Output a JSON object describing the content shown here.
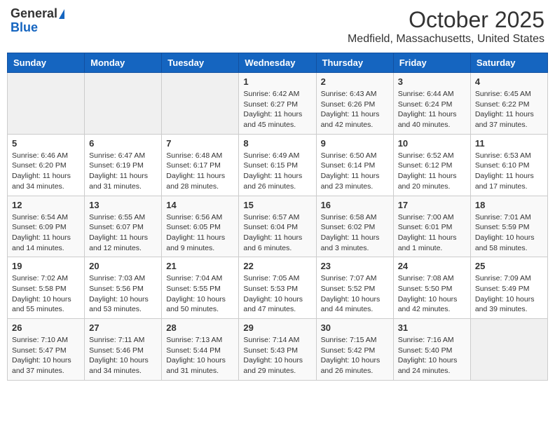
{
  "header": {
    "logo_general": "General",
    "logo_blue": "Blue",
    "month": "October 2025",
    "location": "Medfield, Massachusetts, United States"
  },
  "days_of_week": [
    "Sunday",
    "Monday",
    "Tuesday",
    "Wednesday",
    "Thursday",
    "Friday",
    "Saturday"
  ],
  "weeks": [
    [
      {
        "day": "",
        "content": ""
      },
      {
        "day": "",
        "content": ""
      },
      {
        "day": "",
        "content": ""
      },
      {
        "day": "1",
        "content": "Sunrise: 6:42 AM\nSunset: 6:27 PM\nDaylight: 11 hours and 45 minutes."
      },
      {
        "day": "2",
        "content": "Sunrise: 6:43 AM\nSunset: 6:26 PM\nDaylight: 11 hours and 42 minutes."
      },
      {
        "day": "3",
        "content": "Sunrise: 6:44 AM\nSunset: 6:24 PM\nDaylight: 11 hours and 40 minutes."
      },
      {
        "day": "4",
        "content": "Sunrise: 6:45 AM\nSunset: 6:22 PM\nDaylight: 11 hours and 37 minutes."
      }
    ],
    [
      {
        "day": "5",
        "content": "Sunrise: 6:46 AM\nSunset: 6:20 PM\nDaylight: 11 hours and 34 minutes."
      },
      {
        "day": "6",
        "content": "Sunrise: 6:47 AM\nSunset: 6:19 PM\nDaylight: 11 hours and 31 minutes."
      },
      {
        "day": "7",
        "content": "Sunrise: 6:48 AM\nSunset: 6:17 PM\nDaylight: 11 hours and 28 minutes."
      },
      {
        "day": "8",
        "content": "Sunrise: 6:49 AM\nSunset: 6:15 PM\nDaylight: 11 hours and 26 minutes."
      },
      {
        "day": "9",
        "content": "Sunrise: 6:50 AM\nSunset: 6:14 PM\nDaylight: 11 hours and 23 minutes."
      },
      {
        "day": "10",
        "content": "Sunrise: 6:52 AM\nSunset: 6:12 PM\nDaylight: 11 hours and 20 minutes."
      },
      {
        "day": "11",
        "content": "Sunrise: 6:53 AM\nSunset: 6:10 PM\nDaylight: 11 hours and 17 minutes."
      }
    ],
    [
      {
        "day": "12",
        "content": "Sunrise: 6:54 AM\nSunset: 6:09 PM\nDaylight: 11 hours and 14 minutes."
      },
      {
        "day": "13",
        "content": "Sunrise: 6:55 AM\nSunset: 6:07 PM\nDaylight: 11 hours and 12 minutes."
      },
      {
        "day": "14",
        "content": "Sunrise: 6:56 AM\nSunset: 6:05 PM\nDaylight: 11 hours and 9 minutes."
      },
      {
        "day": "15",
        "content": "Sunrise: 6:57 AM\nSunset: 6:04 PM\nDaylight: 11 hours and 6 minutes."
      },
      {
        "day": "16",
        "content": "Sunrise: 6:58 AM\nSunset: 6:02 PM\nDaylight: 11 hours and 3 minutes."
      },
      {
        "day": "17",
        "content": "Sunrise: 7:00 AM\nSunset: 6:01 PM\nDaylight: 11 hours and 1 minute."
      },
      {
        "day": "18",
        "content": "Sunrise: 7:01 AM\nSunset: 5:59 PM\nDaylight: 10 hours and 58 minutes."
      }
    ],
    [
      {
        "day": "19",
        "content": "Sunrise: 7:02 AM\nSunset: 5:58 PM\nDaylight: 10 hours and 55 minutes."
      },
      {
        "day": "20",
        "content": "Sunrise: 7:03 AM\nSunset: 5:56 PM\nDaylight: 10 hours and 53 minutes."
      },
      {
        "day": "21",
        "content": "Sunrise: 7:04 AM\nSunset: 5:55 PM\nDaylight: 10 hours and 50 minutes."
      },
      {
        "day": "22",
        "content": "Sunrise: 7:05 AM\nSunset: 5:53 PM\nDaylight: 10 hours and 47 minutes."
      },
      {
        "day": "23",
        "content": "Sunrise: 7:07 AM\nSunset: 5:52 PM\nDaylight: 10 hours and 44 minutes."
      },
      {
        "day": "24",
        "content": "Sunrise: 7:08 AM\nSunset: 5:50 PM\nDaylight: 10 hours and 42 minutes."
      },
      {
        "day": "25",
        "content": "Sunrise: 7:09 AM\nSunset: 5:49 PM\nDaylight: 10 hours and 39 minutes."
      }
    ],
    [
      {
        "day": "26",
        "content": "Sunrise: 7:10 AM\nSunset: 5:47 PM\nDaylight: 10 hours and 37 minutes."
      },
      {
        "day": "27",
        "content": "Sunrise: 7:11 AM\nSunset: 5:46 PM\nDaylight: 10 hours and 34 minutes."
      },
      {
        "day": "28",
        "content": "Sunrise: 7:13 AM\nSunset: 5:44 PM\nDaylight: 10 hours and 31 minutes."
      },
      {
        "day": "29",
        "content": "Sunrise: 7:14 AM\nSunset: 5:43 PM\nDaylight: 10 hours and 29 minutes."
      },
      {
        "day": "30",
        "content": "Sunrise: 7:15 AM\nSunset: 5:42 PM\nDaylight: 10 hours and 26 minutes."
      },
      {
        "day": "31",
        "content": "Sunrise: 7:16 AM\nSunset: 5:40 PM\nDaylight: 10 hours and 24 minutes."
      },
      {
        "day": "",
        "content": ""
      }
    ]
  ]
}
